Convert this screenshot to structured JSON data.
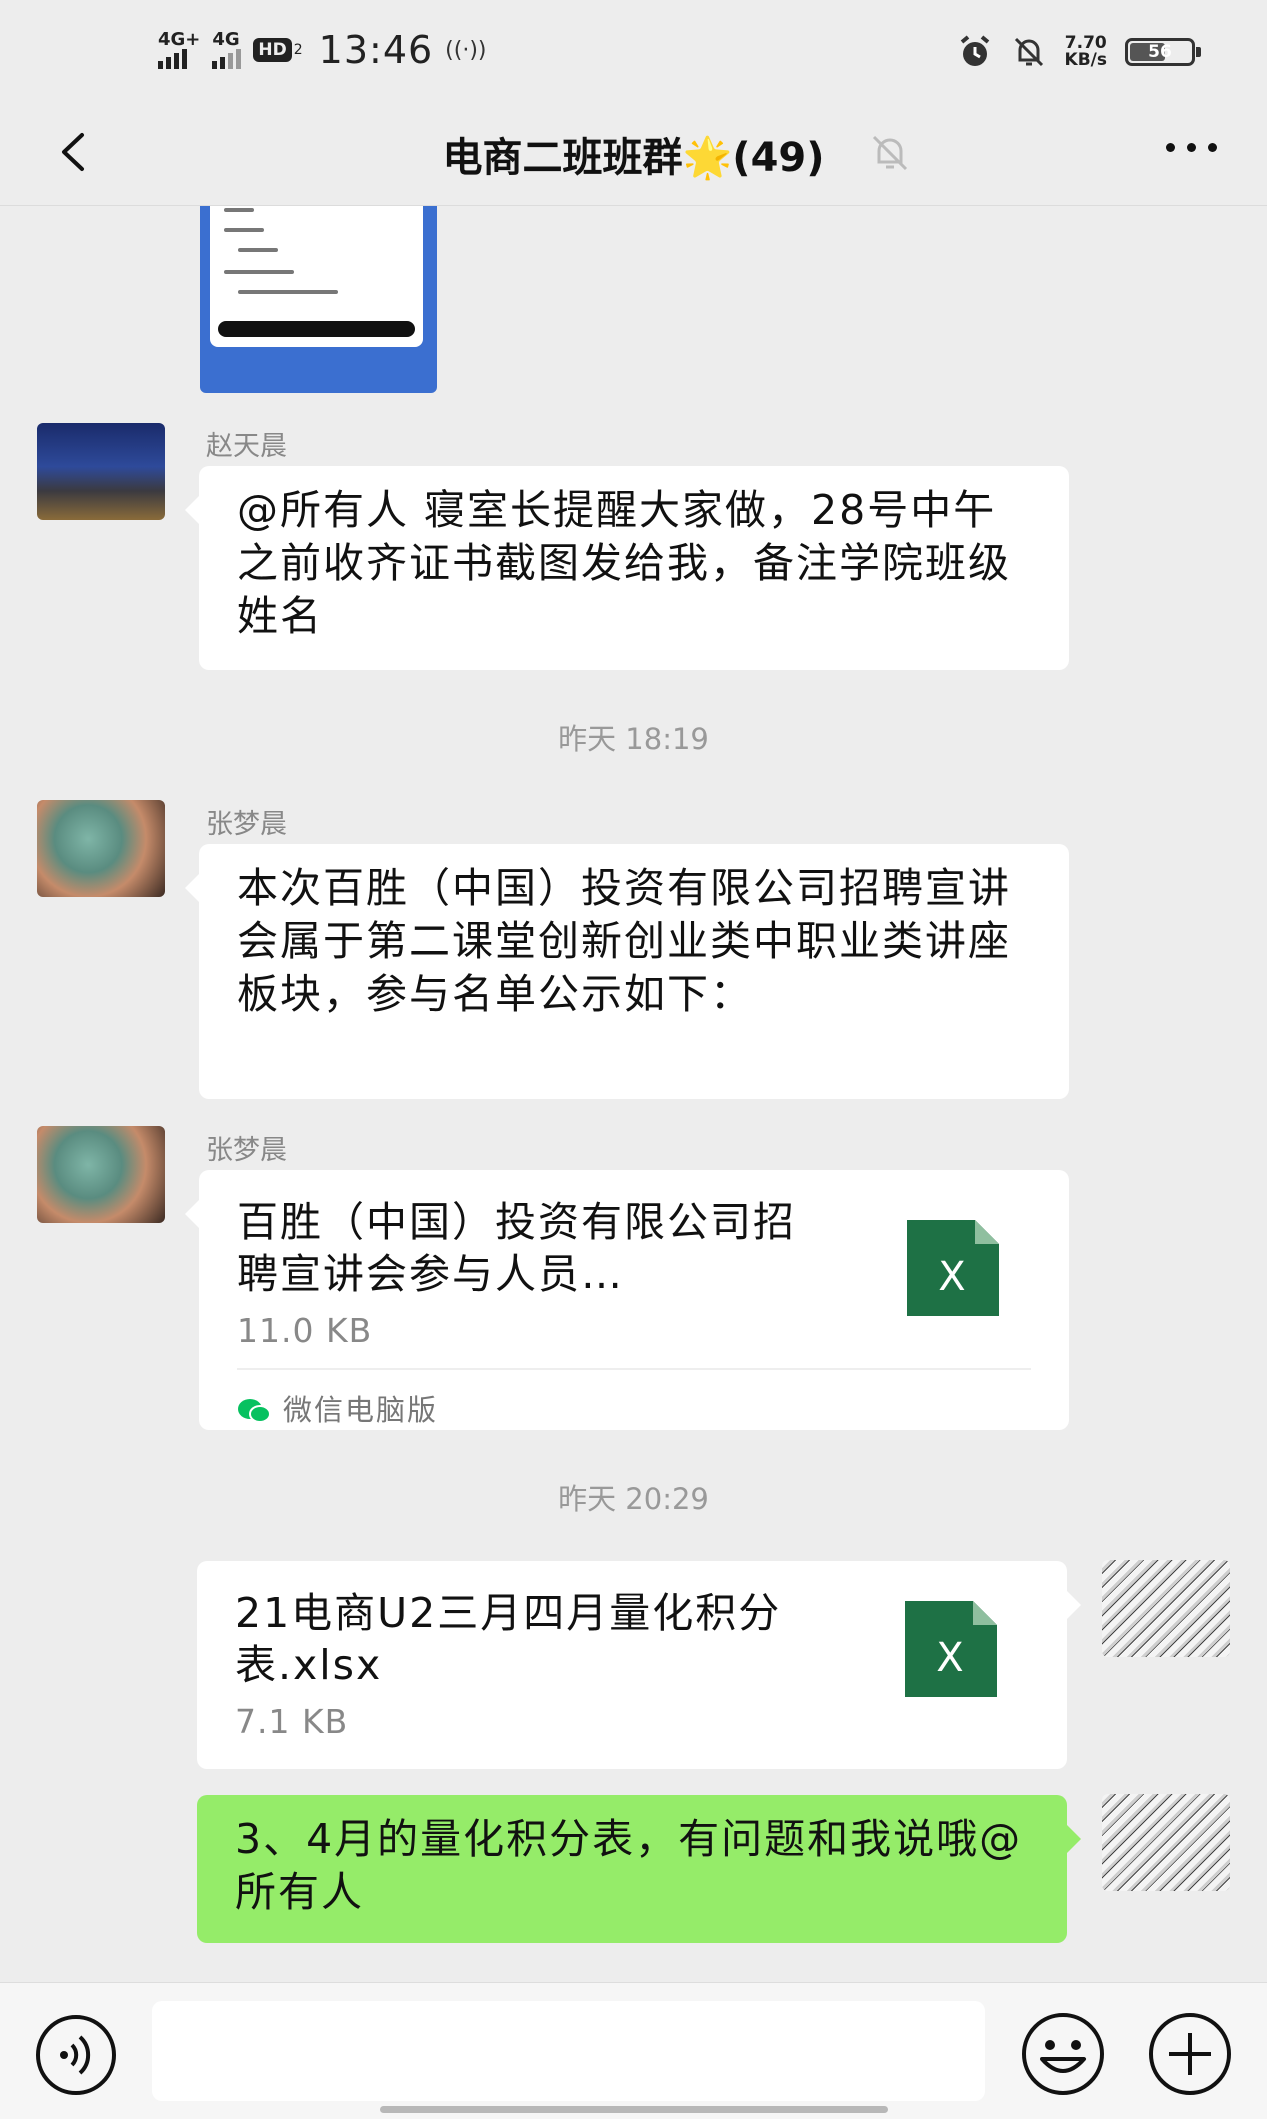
{
  "status_bar": {
    "net1": "4G+",
    "net2": "4G",
    "hd": "HD",
    "hd_sub": "2",
    "time": "13:46",
    "net_speed": "7.70",
    "net_speed_unit": "KB/s",
    "battery": "56"
  },
  "header": {
    "title": "电商二班班群🌟(49)"
  },
  "messages": {
    "m1": {
      "sender": "赵天晨",
      "text": "@所有人  寝室长提醒大家做，28号中午之前收齐证书截图发给我，备注学院班级姓名"
    },
    "time1": "昨天 18:19",
    "m2": {
      "sender": "张梦晨",
      "text": "本次百胜（中国）投资有限公司招聘宣讲会属于第二课堂创新创业类中职业类讲座板块，参与名单公示如下："
    },
    "m3": {
      "sender": "张梦晨",
      "file_name": "百胜（中国）投资有限公司招聘宣讲会参与人员…",
      "file_size": "11.0 KB",
      "source": "微信电脑版"
    },
    "time2": "昨天 20:29",
    "m4": {
      "file_name": "21电商U2三月四月量化积分表.xlsx",
      "file_size": "7.1 KB"
    },
    "m5": {
      "text": "3、4月的量化积分表，有问题和我说哦@所有人"
    }
  },
  "colors": {
    "background": "#ededed",
    "self_bubble": "#95ec69",
    "excel_green": "#1e7145",
    "wechat_green": "#07c160"
  }
}
